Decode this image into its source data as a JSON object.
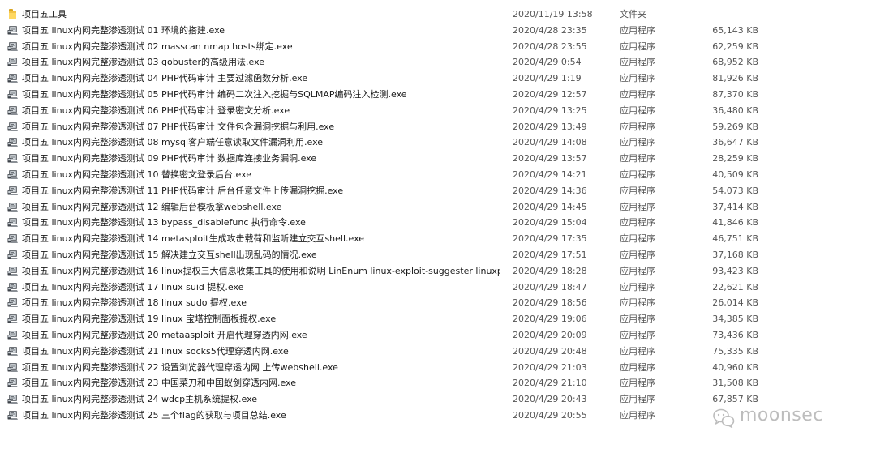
{
  "columns": [
    "name",
    "date_modified",
    "type",
    "size"
  ],
  "folder": {
    "name": "项目五工具",
    "date": "2020/11/19 13:58",
    "type": "文件夹",
    "size": "",
    "icon": "folder-icon"
  },
  "files": [
    {
      "name": "项目五 linux内网完整渗透测试 01 环境的搭建.exe",
      "date": "2020/4/28 23:35",
      "type": "应用程序",
      "size": "65,143 KB",
      "icon": "application-exe-icon"
    },
    {
      "name": "项目五 linux内网完整渗透测试 02 masscan nmap hosts绑定.exe",
      "date": "2020/4/28 23:55",
      "type": "应用程序",
      "size": "62,259 KB",
      "icon": "application-exe-icon"
    },
    {
      "name": "项目五 linux内网完整渗透测试 03 gobuster的高级用法.exe",
      "date": "2020/4/29 0:54",
      "type": "应用程序",
      "size": "68,952 KB",
      "icon": "application-exe-icon"
    },
    {
      "name": "项目五 linux内网完整渗透测试 04 PHP代码审计 主要过滤函数分析.exe",
      "date": "2020/4/29 1:19",
      "type": "应用程序",
      "size": "81,926 KB",
      "icon": "application-exe-icon"
    },
    {
      "name": "项目五 linux内网完整渗透测试 05 PHP代码审计 编码二次注入挖掘与SQLMAP编码注入检测.exe",
      "date": "2020/4/29 12:57",
      "type": "应用程序",
      "size": "87,370 KB",
      "icon": "application-exe-icon"
    },
    {
      "name": "项目五 linux内网完整渗透测试 06 PHP代码审计 登录密文分析.exe",
      "date": "2020/4/29 13:25",
      "type": "应用程序",
      "size": "36,480 KB",
      "icon": "application-exe-icon"
    },
    {
      "name": "项目五 linux内网完整渗透测试 07 PHP代码审计 文件包含漏洞挖掘与利用.exe",
      "date": "2020/4/29 13:49",
      "type": "应用程序",
      "size": "59,269 KB",
      "icon": "application-exe-icon"
    },
    {
      "name": "项目五 linux内网完整渗透测试 08 mysql客户端任意读取文件漏洞利用.exe",
      "date": "2020/4/29 14:08",
      "type": "应用程序",
      "size": "36,647 KB",
      "icon": "application-exe-icon"
    },
    {
      "name": "项目五 linux内网完整渗透测试 09 PHP代码审计 数据库连接业务漏洞.exe",
      "date": "2020/4/29 13:57",
      "type": "应用程序",
      "size": "28,259 KB",
      "icon": "application-exe-icon"
    },
    {
      "name": "项目五 linux内网完整渗透测试 10 替换密文登录后台.exe",
      "date": "2020/4/29 14:21",
      "type": "应用程序",
      "size": "40,509 KB",
      "icon": "application-exe-icon"
    },
    {
      "name": "项目五 linux内网完整渗透测试 11 PHP代码审计 后台任意文件上传漏洞挖掘.exe",
      "date": "2020/4/29 14:36",
      "type": "应用程序",
      "size": "54,073 KB",
      "icon": "application-exe-icon"
    },
    {
      "name": "项目五 linux内网完整渗透测试 12 编辑后台模板拿webshell.exe",
      "date": "2020/4/29 14:45",
      "type": "应用程序",
      "size": "37,414 KB",
      "icon": "application-exe-icon"
    },
    {
      "name": "项目五 linux内网完整渗透测试 13 bypass_disablefunc 执行命令.exe",
      "date": "2020/4/29 15:04",
      "type": "应用程序",
      "size": "41,846 KB",
      "icon": "application-exe-icon"
    },
    {
      "name": "项目五 linux内网完整渗透测试 14 metasploit生成攻击载荷和监听建立交互shell.exe",
      "date": "2020/4/29 17:35",
      "type": "应用程序",
      "size": "46,751 KB",
      "icon": "application-exe-icon"
    },
    {
      "name": "项目五 linux内网完整渗透测试 15 解决建立交互shell出现乱码的情况.exe",
      "date": "2020/4/29 17:51",
      "type": "应用程序",
      "size": "37,168 KB",
      "icon": "application-exe-icon"
    },
    {
      "name": "项目五 linux内网完整渗透测试 16 linux提权三大信息收集工具的使用和说明 LinEnum linux-exploit-suggester linuxp...",
      "date": "2020/4/29 18:28",
      "type": "应用程序",
      "size": "93,423 KB",
      "icon": "application-exe-icon"
    },
    {
      "name": "项目五 linux内网完整渗透测试 17 linux suid 提权.exe",
      "date": "2020/4/29 18:47",
      "type": "应用程序",
      "size": "22,621 KB",
      "icon": "application-exe-icon"
    },
    {
      "name": "项目五 linux内网完整渗透测试 18 linux sudo 提权.exe",
      "date": "2020/4/29 18:56",
      "type": "应用程序",
      "size": "26,014 KB",
      "icon": "application-exe-icon"
    },
    {
      "name": "项目五 linux内网完整渗透测试 19 linux 宝塔控制面板提权.exe",
      "date": "2020/4/29 19:06",
      "type": "应用程序",
      "size": "34,385 KB",
      "icon": "application-exe-icon"
    },
    {
      "name": "项目五 linux内网完整渗透测试 20 metaasploit 开启代理穿透内网.exe",
      "date": "2020/4/29 20:09",
      "type": "应用程序",
      "size": "73,436 KB",
      "icon": "application-exe-icon"
    },
    {
      "name": "项目五 linux内网完整渗透测试 21 linux socks5代理穿透内网.exe",
      "date": "2020/4/29 20:48",
      "type": "应用程序",
      "size": "75,335 KB",
      "icon": "application-exe-icon"
    },
    {
      "name": "项目五 linux内网完整渗透测试 22 设置浏览器代理穿透内网 上传webshell.exe",
      "date": "2020/4/29 21:03",
      "type": "应用程序",
      "size": "40,960 KB",
      "icon": "application-exe-icon"
    },
    {
      "name": "项目五 linux内网完整渗透测试 23 中国菜刀和中国蚁剑穿透内网.exe",
      "date": "2020/4/29 21:10",
      "type": "应用程序",
      "size": "31,508 KB",
      "icon": "application-exe-icon"
    },
    {
      "name": "项目五 linux内网完整渗透测试 24 wdcp主机系统提权.exe",
      "date": "2020/4/29 20:43",
      "type": "应用程序",
      "size": "67,857 KB",
      "icon": "application-exe-icon"
    },
    {
      "name": "项目五 linux内网完整渗透测试 25 三个flag的获取与项目总结.exe",
      "date": "2020/4/29 20:55",
      "type": "应用程序",
      "size": "",
      "icon": "application-exe-icon"
    }
  ],
  "watermark": {
    "text": "moonsec",
    "icon": "wechat-icon"
  },
  "colors": {
    "folder": "#f3c042",
    "text": "#1a1a1a",
    "secondary_text": "#555555",
    "watermark": "#bdbdbd"
  }
}
